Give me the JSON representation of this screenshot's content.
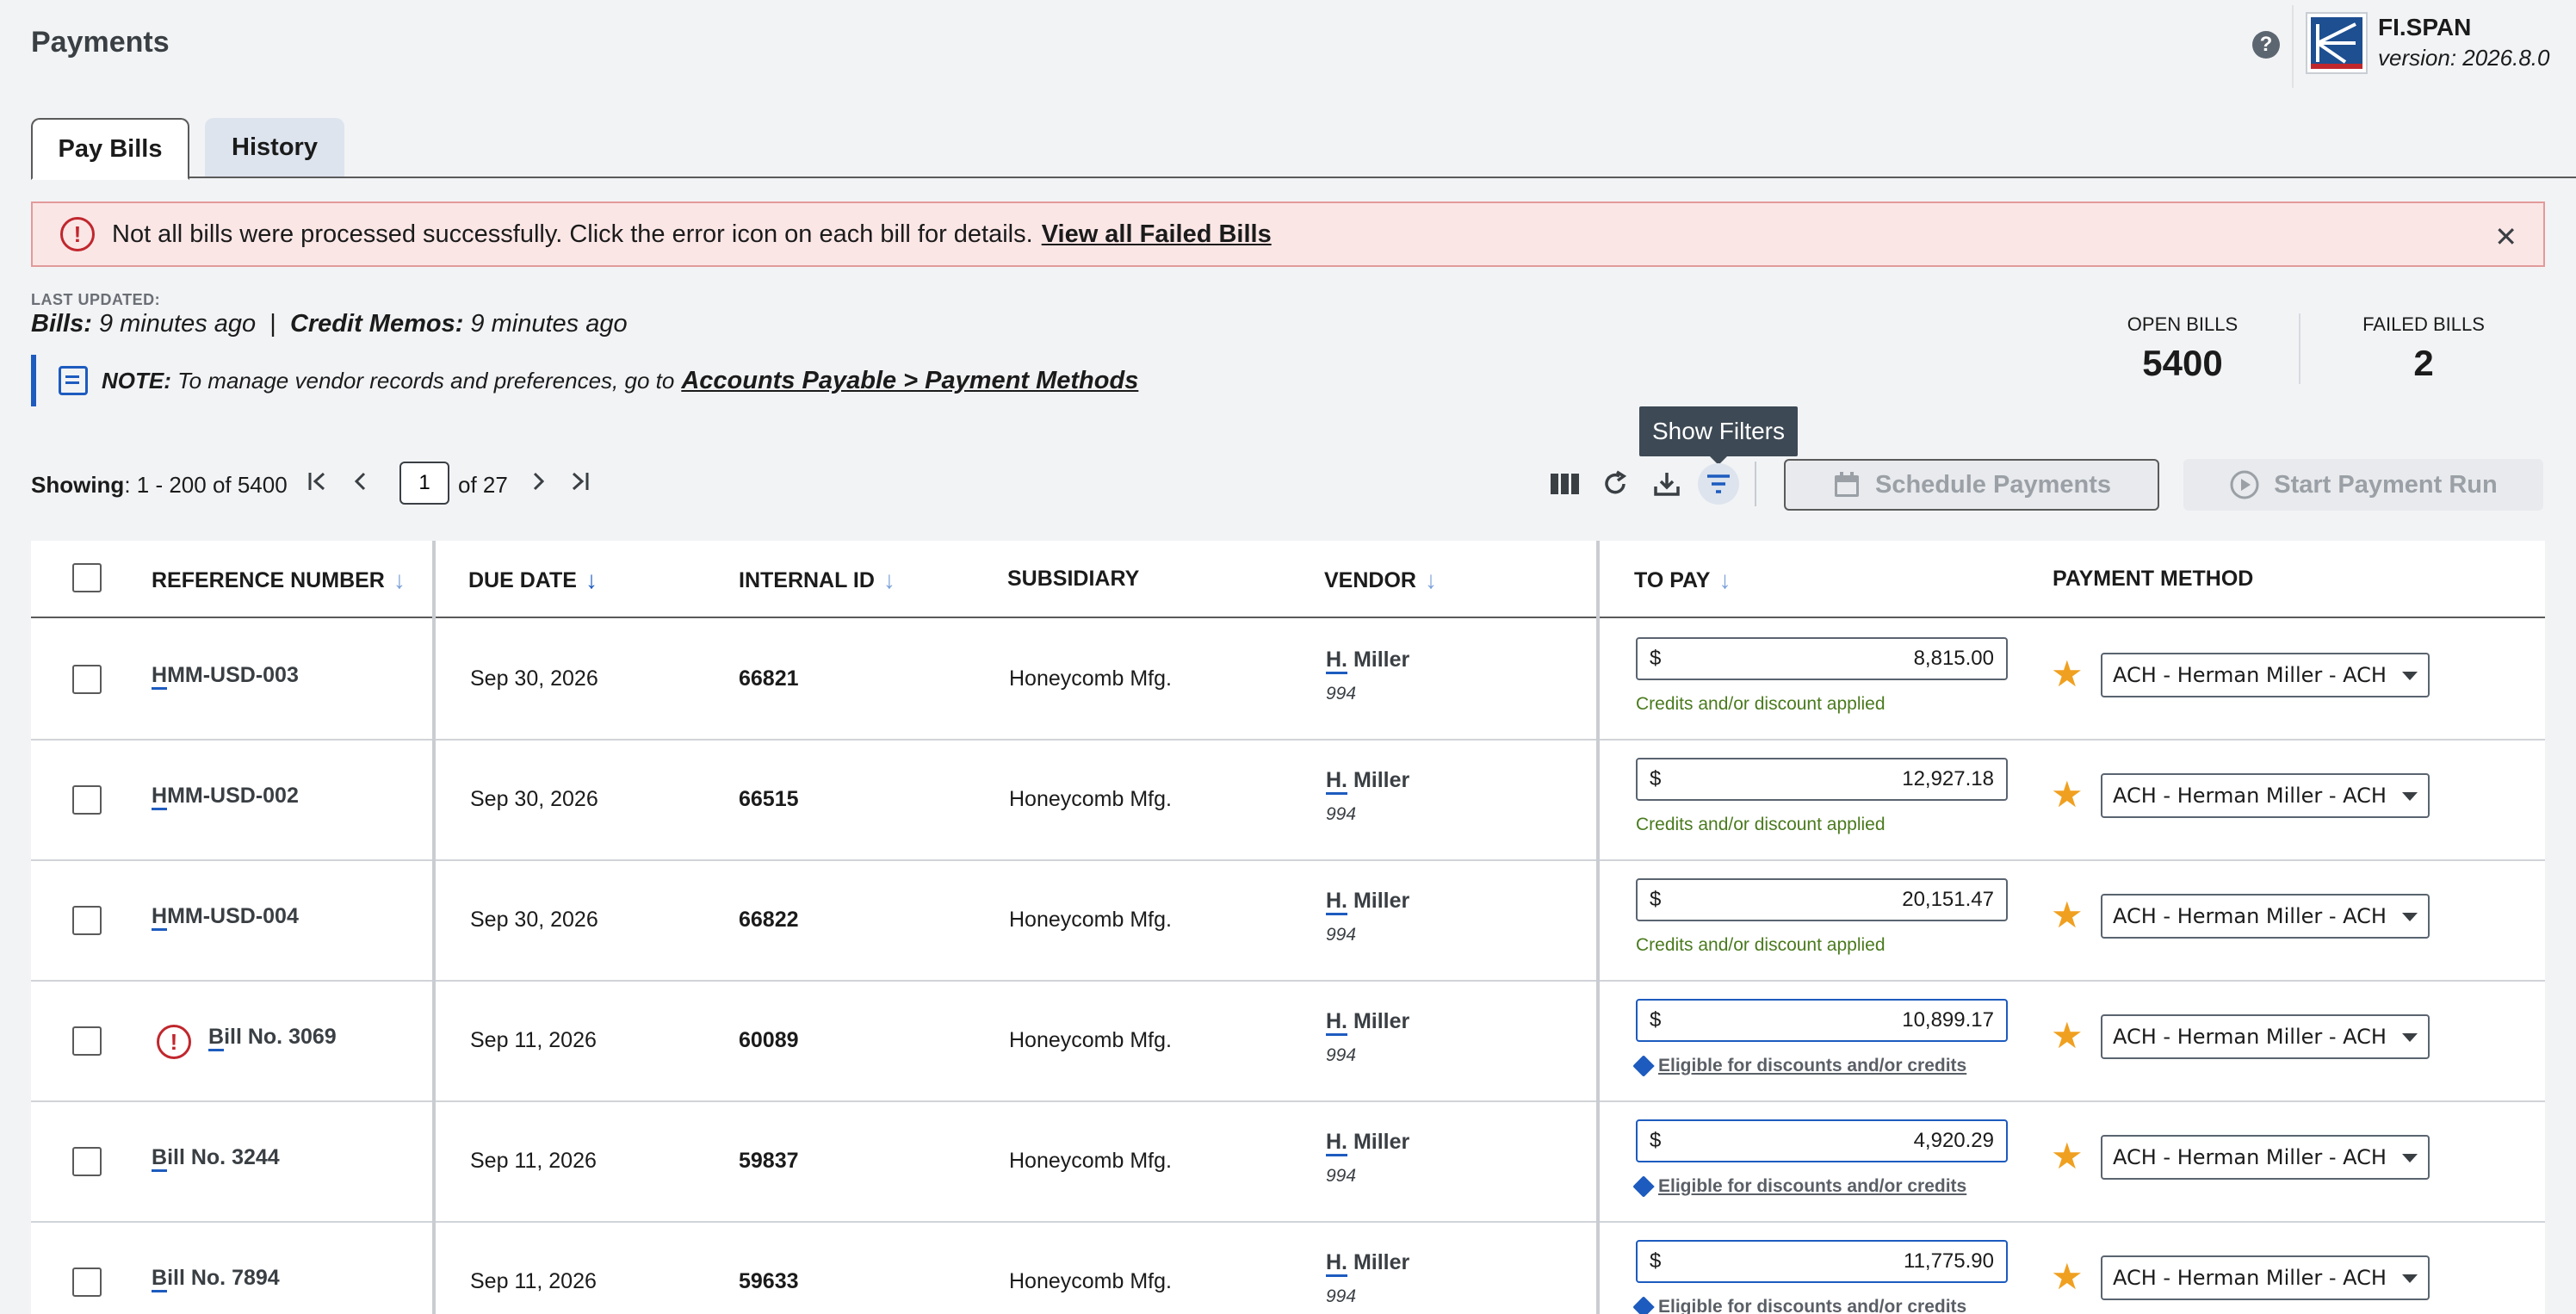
{
  "header": {
    "title": "Payments",
    "brand": "FI.SPAN",
    "version": "version: 2026.8.0"
  },
  "tabs": [
    {
      "label": "Pay Bills",
      "active": true
    },
    {
      "label": "History",
      "active": false
    }
  ],
  "alert": {
    "message": "Not all bills were processed successfully. Click the error icon on each bill for details.",
    "link": "View all Failed Bills"
  },
  "last_updated": {
    "label": "LAST UPDATED:",
    "bills_label": "Bills:",
    "bills_value": "9 minutes ago",
    "separator": "|",
    "credit_label": "Credit Memos:",
    "credit_value": "9 minutes ago"
  },
  "note": {
    "label": "NOTE:",
    "text": "To manage vendor records and preferences, go to",
    "link": "Accounts Payable > Payment Methods"
  },
  "counters": {
    "open_label": "OPEN BILLS",
    "open_value": "5400",
    "failed_label": "FAILED BILLS",
    "failed_value": "2"
  },
  "tooltip": "Show Filters",
  "pagination": {
    "showing_label": "Showing",
    "range": ": 1 - 200 of 5400",
    "page": "1",
    "of": "of 27"
  },
  "toolbar": {
    "schedule": "Schedule Payments",
    "start": "Start Payment Run"
  },
  "columns": {
    "ref": "REFERENCE NUMBER",
    "due": "DUE DATE",
    "internal": "INTERNAL ID",
    "subsidiary": "SUBSIDIARY",
    "vendor": "VENDOR",
    "topay": "TO PAY",
    "method": "PAYMENT METHOD"
  },
  "rows": [
    {
      "ref_first": "H",
      "ref_rest": "MM-USD-003",
      "due": "Sep 30, 2026",
      "internal": "66821",
      "subsidiary": "Honeycomb Mfg.",
      "vendor_first": "H.",
      "vendor_rest": " Miller",
      "vendor_id": "994",
      "currency": "$",
      "amount": "8,815.00",
      "note": "Credits and/or discount applied",
      "note_type": "green",
      "method": "ACH - Herman Miller - ACH",
      "error": false
    },
    {
      "ref_first": "H",
      "ref_rest": "MM-USD-002",
      "due": "Sep 30, 2026",
      "internal": "66515",
      "subsidiary": "Honeycomb Mfg.",
      "vendor_first": "H.",
      "vendor_rest": " Miller",
      "vendor_id": "994",
      "currency": "$",
      "amount": "12,927.18",
      "note": "Credits and/or discount applied",
      "note_type": "green",
      "method": "ACH - Herman Miller - ACH",
      "error": false
    },
    {
      "ref_first": "H",
      "ref_rest": "MM-USD-004",
      "due": "Sep 30, 2026",
      "internal": "66822",
      "subsidiary": "Honeycomb Mfg.",
      "vendor_first": "H.",
      "vendor_rest": " Miller",
      "vendor_id": "994",
      "currency": "$",
      "amount": "20,151.47",
      "note": "Credits and/or discount applied",
      "note_type": "green",
      "method": "ACH - Herman Miller - ACH",
      "error": false
    },
    {
      "ref_first": "B",
      "ref_rest": "ill No. 3069",
      "due": "Sep 11, 2026",
      "internal": "60089",
      "subsidiary": "Honeycomb Mfg.",
      "vendor_first": "H.",
      "vendor_rest": " Miller",
      "vendor_id": "994",
      "currency": "$",
      "amount": "10,899.17",
      "note": "Eligible for discounts and/or credits",
      "note_type": "link",
      "method": "ACH - Herman Miller - ACH",
      "error": true
    },
    {
      "ref_first": "B",
      "ref_rest": "ill No. 3244",
      "due": "Sep 11, 2026",
      "internal": "59837",
      "subsidiary": "Honeycomb Mfg.",
      "vendor_first": "H.",
      "vendor_rest": " Miller",
      "vendor_id": "994",
      "currency": "$",
      "amount": "4,920.29",
      "note": "Eligible for discounts and/or credits",
      "note_type": "link",
      "method": "ACH - Herman Miller - ACH",
      "error": false
    },
    {
      "ref_first": "B",
      "ref_rest": "ill No. 7894",
      "due": "Sep 11, 2026",
      "internal": "59633",
      "subsidiary": "Honeycomb Mfg.",
      "vendor_first": "H.",
      "vendor_rest": " Miller",
      "vendor_id": "994",
      "currency": "$",
      "amount": "11,775.90",
      "note": "Eligible for discounts and/or credits",
      "note_type": "link",
      "method": "ACH - Herman Miller - ACH",
      "error": false
    }
  ],
  "colors": {
    "accent": "#1d5bbf",
    "error": "#c0272d",
    "star": "#f0a020",
    "success_text": "#4a7a1e",
    "alert_bg": "#fbe6e6"
  },
  "icons": {
    "help": "help-icon",
    "close": "close-icon",
    "error": "error-icon",
    "note": "note-icon",
    "first_page": "first-page-icon",
    "prev_page": "prev-page-icon",
    "next_page": "next-page-icon",
    "last_page": "last-page-icon",
    "columns": "columns-icon",
    "refresh": "refresh-icon",
    "download": "download-icon",
    "filter": "filter-icon",
    "calendar": "calendar-icon",
    "play": "play-icon",
    "star": "star-icon",
    "tag": "tag-icon",
    "sort": "sort-arrow-icon"
  }
}
